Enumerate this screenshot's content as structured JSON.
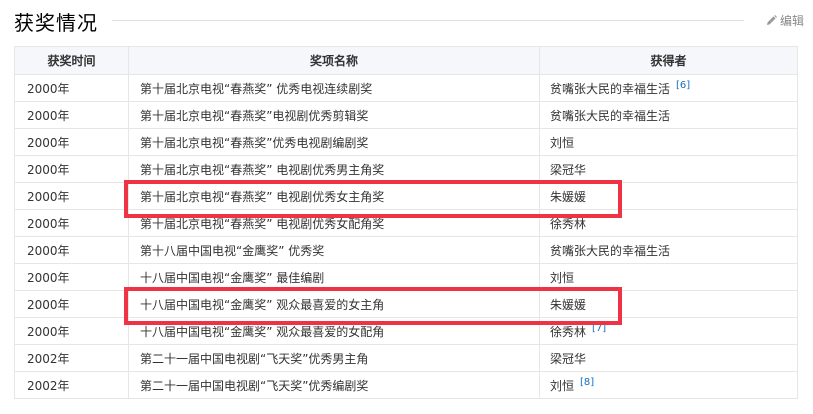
{
  "section": {
    "title": "获奖情况",
    "edit_label": "编辑",
    "edit_icon": "pencil-icon"
  },
  "table": {
    "headers": [
      "获奖时间",
      "奖项名称",
      "获得者"
    ],
    "rows": [
      {
        "year": "2000年",
        "award": "第十届北京电视“春燕奖” 优秀电视连续剧奖",
        "winner": "贫嘴张大民的幸福生活",
        "ref": "[6]"
      },
      {
        "year": "2000年",
        "award": "第十届北京电视“春燕奖”电视剧优秀剪辑奖",
        "winner": "贫嘴张大民的幸福生活",
        "ref": ""
      },
      {
        "year": "2000年",
        "award": "第十届北京电视“春燕奖”优秀电视剧编剧奖",
        "winner": "刘恒",
        "ref": ""
      },
      {
        "year": "2000年",
        "award": "第十届北京电视“春燕奖” 电视剧优秀男主角奖",
        "winner": "梁冠华",
        "ref": ""
      },
      {
        "year": "2000年",
        "award": "第十届北京电视“春燕奖” 电视剧优秀女主角奖",
        "winner": "朱媛媛",
        "ref": ""
      },
      {
        "year": "2000年",
        "award": "第十届北京电视“春燕奖” 电视剧优秀女配角奖",
        "winner": "徐秀林",
        "ref": ""
      },
      {
        "year": "2000年",
        "award": "第十八届中国电视“金鹰奖” 优秀奖",
        "winner": "贫嘴张大民的幸福生活",
        "ref": ""
      },
      {
        "year": "2000年",
        "award": "十八届中国电视“金鹰奖” 最佳编剧",
        "winner": "刘恒",
        "ref": ""
      },
      {
        "year": "2000年",
        "award": "十八届中国电视“金鹰奖” 观众最喜爱的女主角",
        "winner": "朱媛媛",
        "ref": ""
      },
      {
        "year": "2000年",
        "award": "十八届中国电视“金鹰奖” 观众最喜爱的女配角",
        "winner": "徐秀林",
        "ref": "[7]"
      },
      {
        "year": "2002年",
        "award": "第二十一届中国电视剧“飞天奖”优秀男主角",
        "winner": "梁冠华",
        "ref": ""
      },
      {
        "year": "2002年",
        "award": "第二十一届中国电视剧“飞天奖”优秀编剧奖",
        "winner": "刘恒",
        "ref": "[8]"
      }
    ]
  },
  "colors": {
    "highlight": "#ee3344",
    "link": "#136ec2",
    "header_bg": "#f5f7fb",
    "border": "#e6e6e6"
  }
}
